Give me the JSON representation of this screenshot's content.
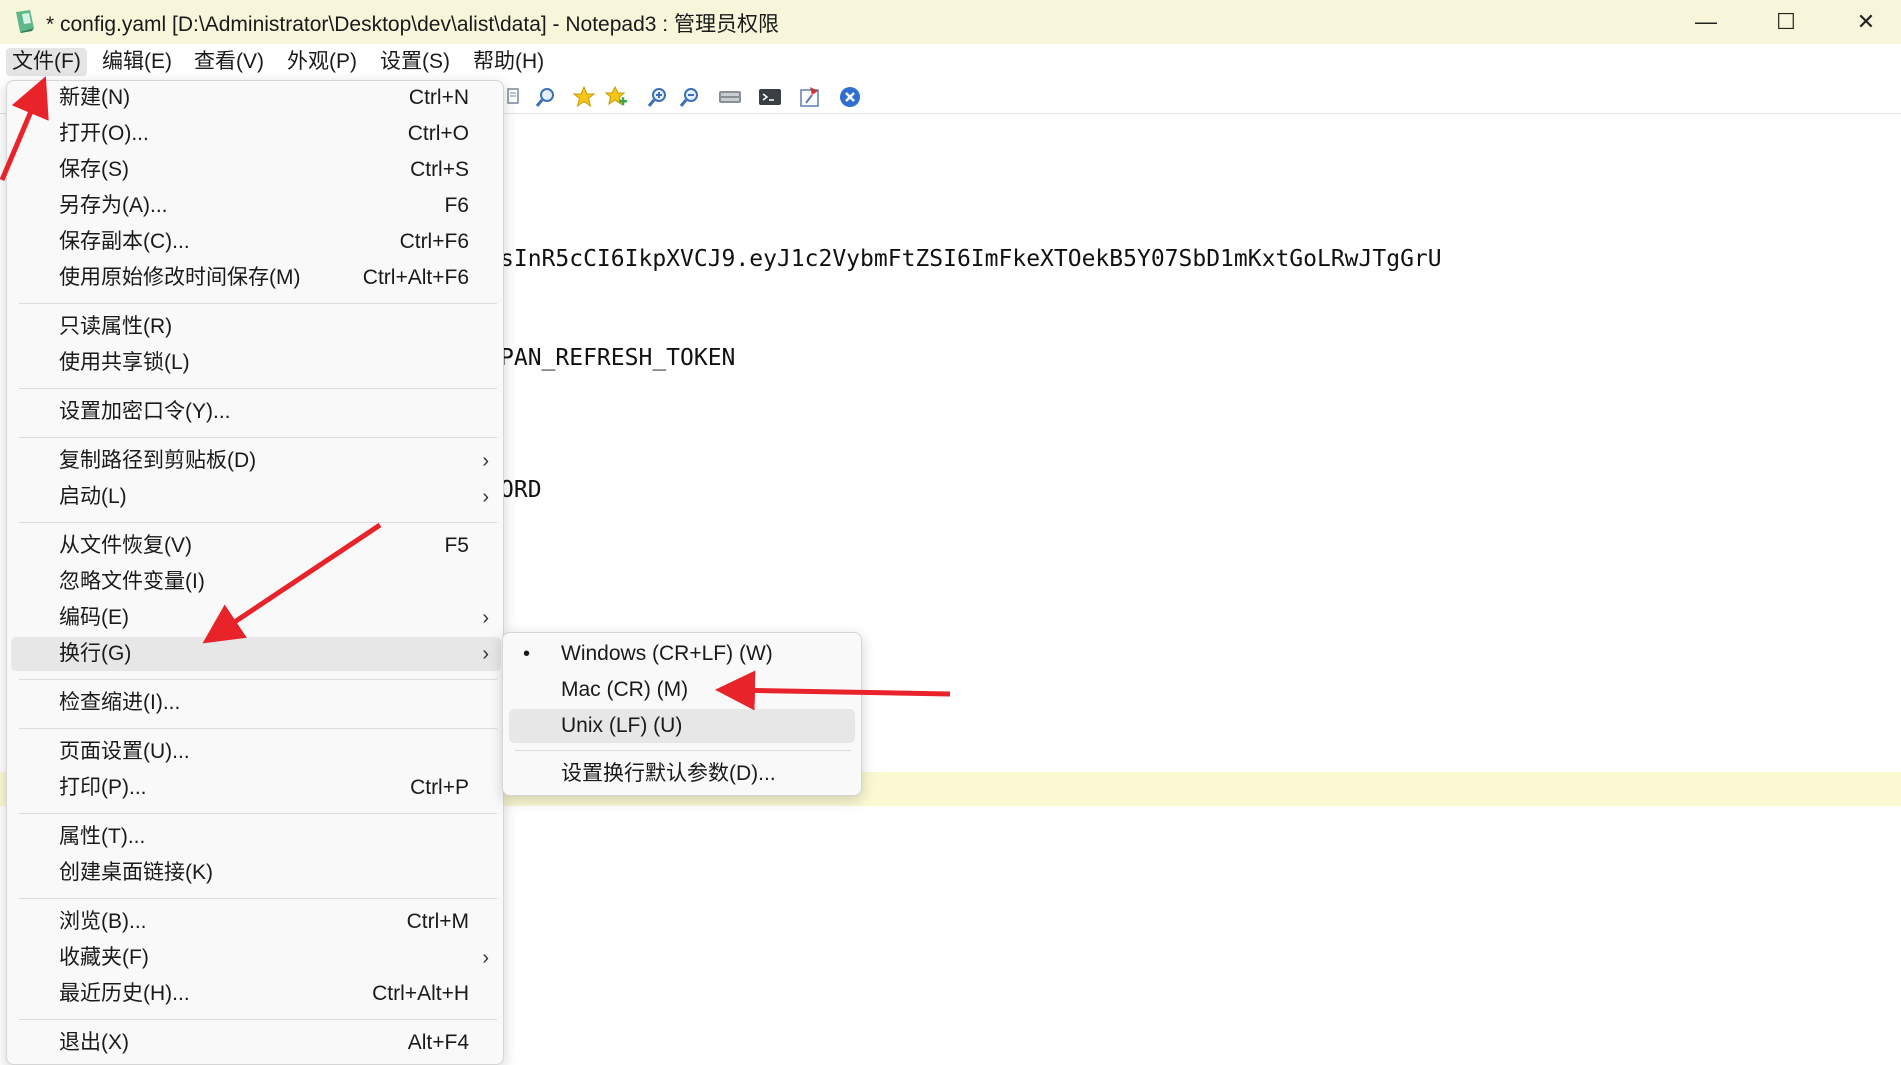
{
  "window": {
    "title": "* config.yaml [D:\\Administrator\\Desktop\\dev\\alist\\data] - Notepad3 : 管理员权限",
    "minimize_glyph": "—",
    "maximize_glyph": "☐",
    "close_glyph": "✕"
  },
  "menubar": {
    "items": [
      {
        "label": "文件(F)"
      },
      {
        "label": "编辑(E)"
      },
      {
        "label": "查看(V)"
      },
      {
        "label": "外观(P)"
      },
      {
        "label": "设置(S)"
      },
      {
        "label": "帮助(H)"
      }
    ]
  },
  "toolbar": {
    "icons": [
      "find-icon",
      "zoom-find-icon",
      "favorite-star-icon",
      "add-favorite-icon",
      "zoom-in-icon",
      "zoom-out-icon",
      "keyboard-icon",
      "terminal-icon",
      "pin-icon",
      "close-circle-icon"
    ]
  },
  "editor": {
    "lines": [
      "sInR5cCI6IkpXVCJ9.eyJ1c2VybmFtZSI6ImFkeXTOekB5Y07SbD1mKxtGoLRwJTgGrU",
      "PAN_REFRESH_TOKEN",
      "ORD"
    ]
  },
  "file_menu": {
    "items": [
      {
        "label": "新建(N)",
        "accel": "Ctrl+N"
      },
      {
        "label": "打开(O)...",
        "accel": "Ctrl+O"
      },
      {
        "label": "保存(S)",
        "accel": "Ctrl+S"
      },
      {
        "label": "另存为(A)...",
        "accel": "F6"
      },
      {
        "label": "保存副本(C)...",
        "accel": "Ctrl+F6"
      },
      {
        "label": "使用原始修改时间保存(M)",
        "accel": "Ctrl+Alt+F6"
      },
      {
        "label": "只读属性(R)",
        "accel": ""
      },
      {
        "label": "使用共享锁(L)",
        "accel": ""
      },
      {
        "label": "设置加密口令(Y)...",
        "accel": ""
      },
      {
        "label": "复制路径到剪贴板(D)",
        "accel": "",
        "submenu": "›"
      },
      {
        "label": "启动(L)",
        "accel": "",
        "submenu": "›"
      },
      {
        "label": "从文件恢复(V)",
        "accel": "F5"
      },
      {
        "label": "忽略文件变量(I)",
        "accel": ""
      },
      {
        "label": "编码(E)",
        "accel": "",
        "submenu": "›"
      },
      {
        "label": "换行(G)",
        "accel": "",
        "submenu": "›"
      },
      {
        "label": "检查缩进(I)...",
        "accel": ""
      },
      {
        "label": "页面设置(U)...",
        "accel": ""
      },
      {
        "label": "打印(P)...",
        "accel": "Ctrl+P"
      },
      {
        "label": "属性(T)...",
        "accel": ""
      },
      {
        "label": "创建桌面链接(K)",
        "accel": ""
      },
      {
        "label": "浏览(B)...",
        "accel": "Ctrl+M"
      },
      {
        "label": "收藏夹(F)",
        "accel": "",
        "submenu": "›"
      },
      {
        "label": "最近历史(H)...",
        "accel": "Ctrl+Alt+H"
      },
      {
        "label": "退出(X)",
        "accel": "Alt+F4"
      }
    ]
  },
  "line_ending_submenu": {
    "items": [
      {
        "label": "Windows (CR+LF) (W)",
        "bullet": "•"
      },
      {
        "label": "Mac (CR) (M)",
        "bullet": ""
      },
      {
        "label": "Unix (LF) (U)",
        "bullet": ""
      },
      {
        "label": "设置换行默认参数(D)...",
        "bullet": ""
      }
    ]
  },
  "colors": {
    "titlebar": "#f7f6db",
    "current_line": "#fbf9d2",
    "annotation_arrow": "#e8232a"
  }
}
